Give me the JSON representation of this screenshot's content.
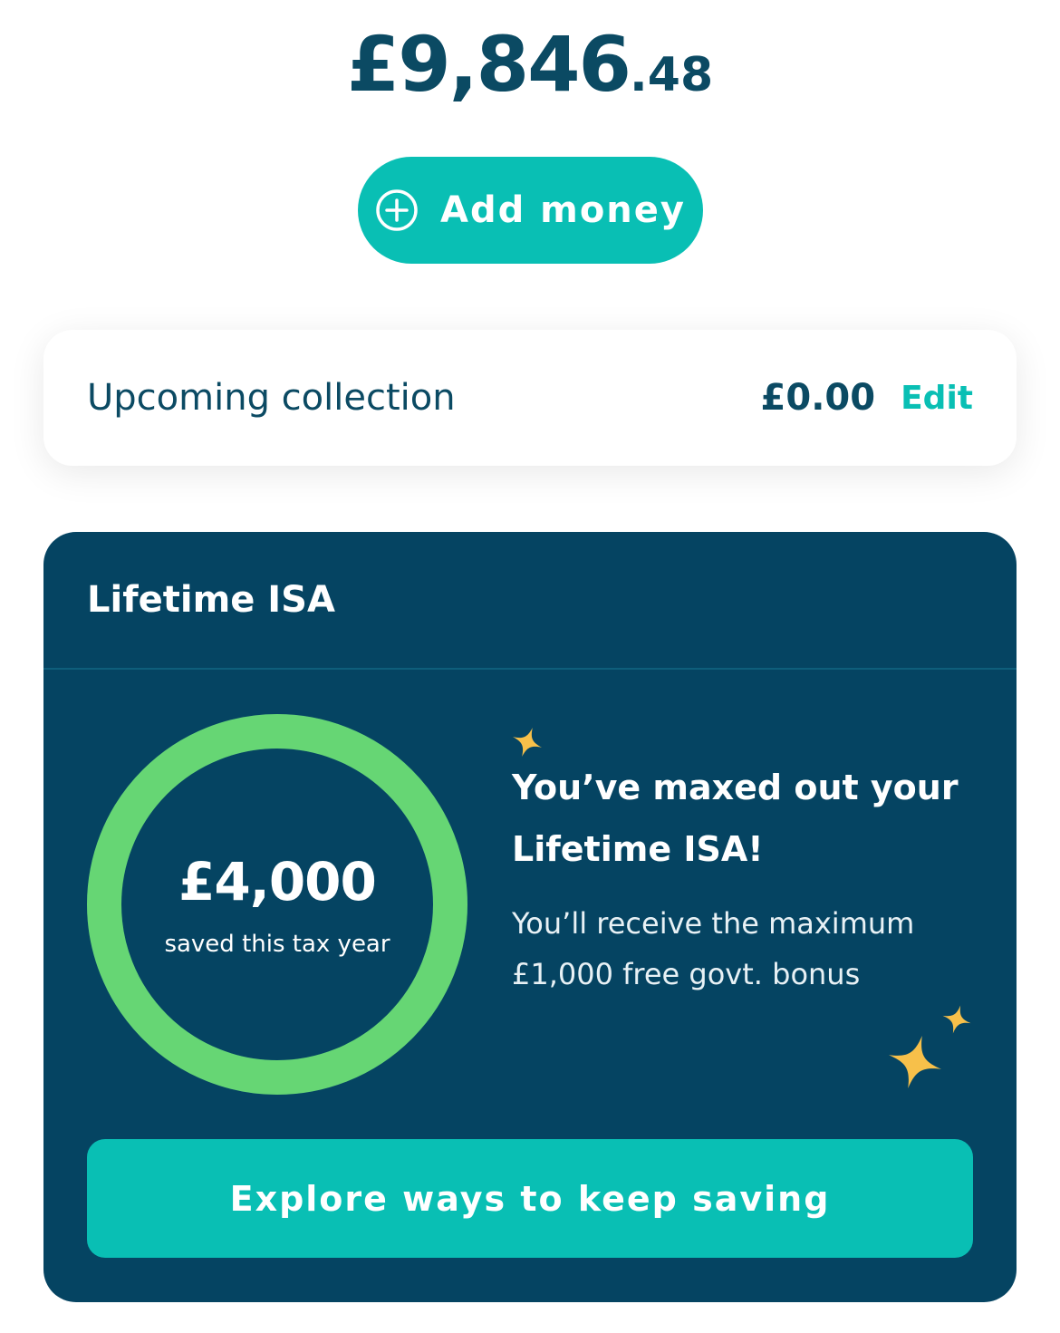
{
  "balance": {
    "whole": "£9,846",
    "pence": ".48"
  },
  "add_money": {
    "label": "Add money",
    "icon": "plus-circle-icon"
  },
  "collection": {
    "label": "Upcoming collection",
    "amount": "£0.00",
    "edit_label": "Edit"
  },
  "lisa": {
    "title": "Lifetime ISA",
    "saved_amount": "£4,000",
    "saved_caption": "saved this tax year",
    "progress_fraction": 1.0,
    "message_title": "You’ve maxed out your Lifetime ISA!",
    "message_body": "You’ll receive the maximum £1,000 free govt. bonus",
    "explore_label": "Explore ways to keep saving"
  },
  "colors": {
    "navy": "#054462",
    "text_dark": "#0b4a63",
    "teal": "#09bfb4",
    "ring_green": "#66d674",
    "star_yellow": "#f7c04a"
  }
}
